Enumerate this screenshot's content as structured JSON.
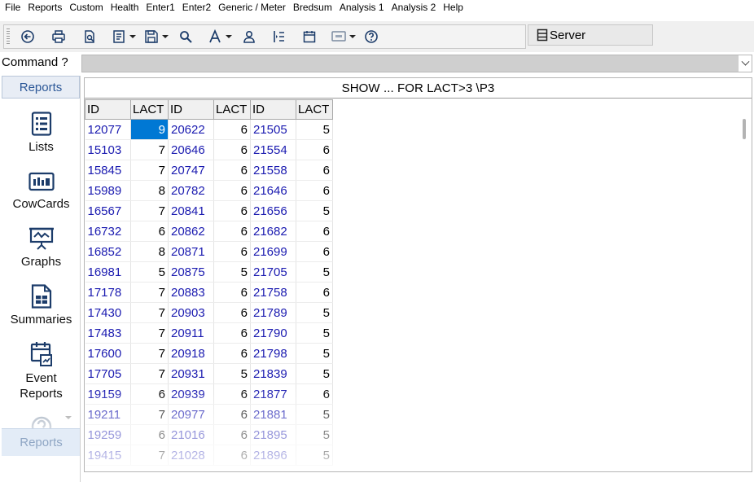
{
  "menu": [
    "File",
    "Reports",
    "Custom",
    "Health",
    "Enter1",
    "Enter2",
    "Generic / Meter",
    "Bredsum",
    "Analysis 1",
    "Analysis 2",
    "Help"
  ],
  "toolbar": {
    "icons": [
      "back-icon",
      "print-icon",
      "print-preview-icon",
      "page-setup-icon",
      "save-icon",
      "search-icon",
      "font-icon",
      "user-icon",
      "column-icon",
      "calendar-icon",
      "message-icon",
      "help-icon"
    ],
    "server_label": "Server"
  },
  "command": {
    "label": "Command ?",
    "value": ""
  },
  "leftnav": {
    "header": "Reports",
    "items": [
      {
        "label": "Lists",
        "icon": "list-icon"
      },
      {
        "label": "CowCards",
        "icon": "cowcard-icon"
      },
      {
        "label": "Graphs",
        "icon": "graph-icon"
      },
      {
        "label": "Summaries",
        "icon": "summary-icon"
      },
      {
        "label": "Event Reports",
        "icon": "event-report-icon"
      }
    ],
    "bottom_button": "Reports"
  },
  "report": {
    "title": "SHOW ...  FOR LACT>3 \\P3",
    "columns": [
      "ID",
      "LACT",
      "ID",
      "LACT",
      "ID",
      "LACT"
    ],
    "rows": [
      [
        "12077",
        "9",
        "20622",
        "6",
        "21505",
        "5"
      ],
      [
        "15103",
        "7",
        "20646",
        "6",
        "21554",
        "6"
      ],
      [
        "15845",
        "7",
        "20747",
        "6",
        "21558",
        "6"
      ],
      [
        "15989",
        "8",
        "20782",
        "6",
        "21646",
        "6"
      ],
      [
        "16567",
        "7",
        "20841",
        "6",
        "21656",
        "5"
      ],
      [
        "16732",
        "6",
        "20862",
        "6",
        "21682",
        "6"
      ],
      [
        "16852",
        "8",
        "20871",
        "6",
        "21699",
        "6"
      ],
      [
        "16981",
        "5",
        "20875",
        "5",
        "21705",
        "5"
      ],
      [
        "17178",
        "7",
        "20883",
        "6",
        "21758",
        "6"
      ],
      [
        "17430",
        "7",
        "20903",
        "6",
        "21789",
        "5"
      ],
      [
        "17483",
        "7",
        "20911",
        "6",
        "21790",
        "5"
      ],
      [
        "17600",
        "7",
        "20918",
        "6",
        "21798",
        "5"
      ],
      [
        "17705",
        "7",
        "20931",
        "5",
        "21839",
        "5"
      ],
      [
        "19159",
        "6",
        "20939",
        "6",
        "21877",
        "6"
      ],
      [
        "19211",
        "7",
        "20977",
        "6",
        "21881",
        "5"
      ],
      [
        "19259",
        "6",
        "21016",
        "6",
        "21895",
        "5"
      ],
      [
        "19415",
        "7",
        "21028",
        "6",
        "21896",
        "5"
      ]
    ],
    "selected_cell": {
      "row": 0,
      "col": 1
    }
  }
}
